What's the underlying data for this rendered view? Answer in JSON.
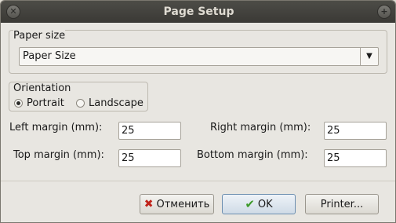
{
  "window": {
    "title": "Page Setup"
  },
  "paper": {
    "group_title": "Paper size",
    "selected": "Paper Size"
  },
  "orientation": {
    "group_title": "Orientation",
    "options": [
      "Portrait",
      "Landscape"
    ],
    "selected": "Portrait"
  },
  "margins": {
    "left_label": "Left margin (mm):",
    "left_value": "25",
    "right_label": "Right margin (mm):",
    "right_value": "25",
    "top_label": "Top margin (mm):",
    "top_value": "25",
    "bottom_label": "Bottom margin (mm):",
    "bottom_value": "25"
  },
  "buttons": {
    "cancel": "Отменить",
    "ok": "OK",
    "printer": "Printer..."
  },
  "icons": {
    "close": "close-icon",
    "maximize": "maximize-icon",
    "cancel": "cross-icon",
    "ok": "check-icon",
    "dropdown": "triangle-down-icon"
  }
}
